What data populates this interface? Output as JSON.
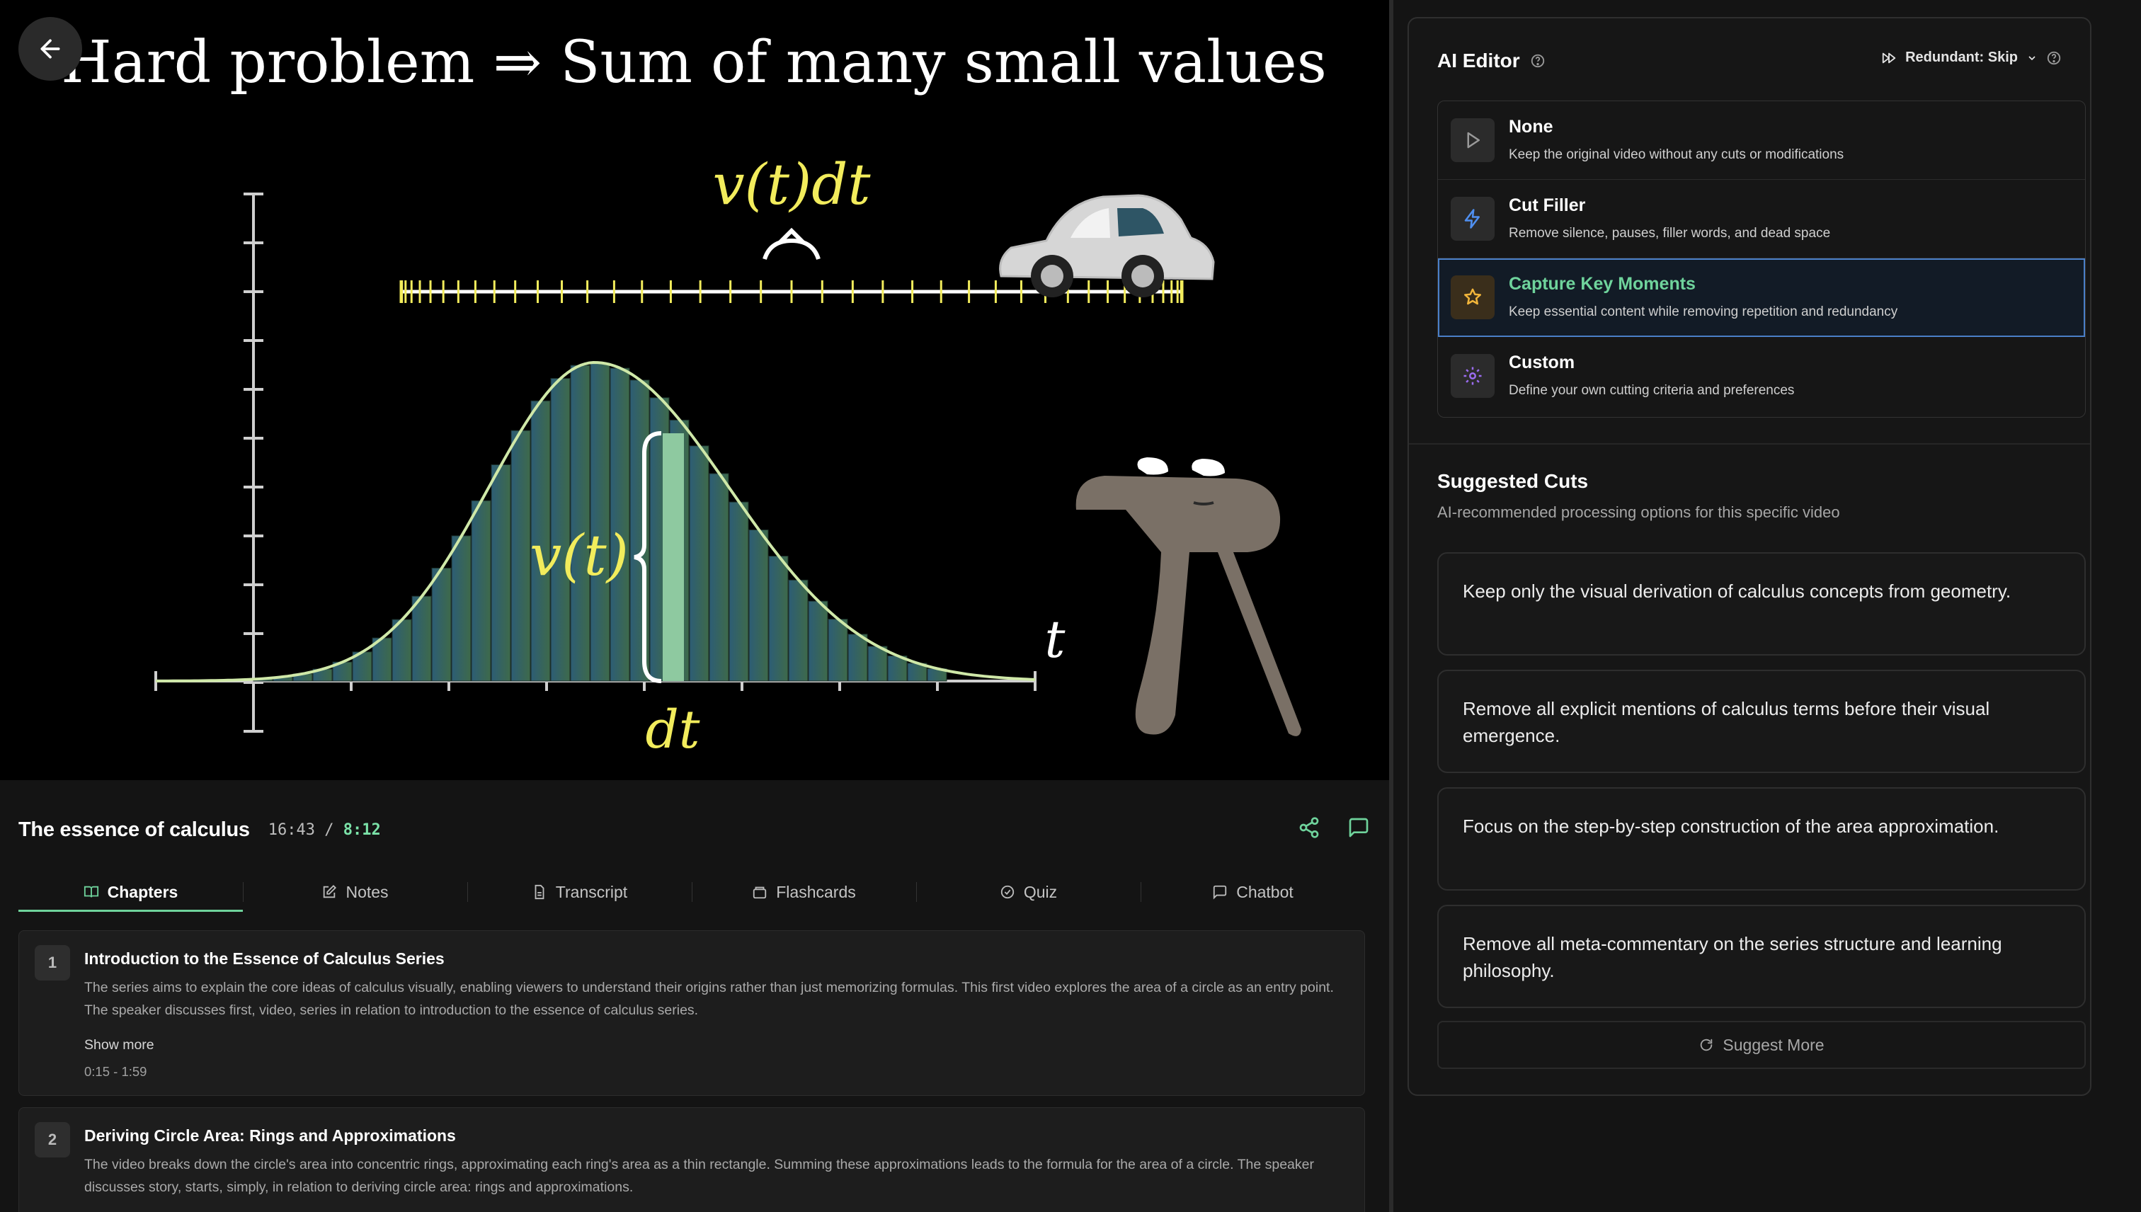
{
  "video": {
    "back_icon": "arrow-left-icon",
    "slide_title": "Hard problem ⇒ Sum of many small values",
    "label_vdt": "v(t)dt",
    "label_vt": "v(t)",
    "label_dt": "dt",
    "label_t": "t",
    "curve_color": "#d4f0a0",
    "label_color": "#f2ec5c"
  },
  "info": {
    "title": "The essence of calculus",
    "current_time": "16:43",
    "separator": "/",
    "duration": "8:12",
    "share_icon": "share-icon",
    "chat_icon": "message-icon"
  },
  "tabs": [
    {
      "label": "Chapters",
      "icon": "book-icon"
    },
    {
      "label": "Notes",
      "icon": "edit-icon"
    },
    {
      "label": "Transcript",
      "icon": "file-text-icon"
    },
    {
      "label": "Flashcards",
      "icon": "cards-icon"
    },
    {
      "label": "Quiz",
      "icon": "check-circle-icon"
    },
    {
      "label": "Chatbot",
      "icon": "message-icon"
    }
  ],
  "chapters": [
    {
      "num": "1",
      "title": "Introduction to the Essence of Calculus Series",
      "desc": "The series aims to explain the core ideas of calculus visually, enabling viewers to understand their origins rather than just memorizing formulas. This first video explores the area of a circle as an entry point. The speaker discusses first, video, series in relation to introduction to the essence of calculus series.",
      "more": "Show more",
      "range": "0:15 - 1:59"
    },
    {
      "num": "2",
      "title": "Deriving Circle Area: Rings and Approximations",
      "desc": "The video breaks down the circle's area into concentric rings, approximating each ring's area as a thin rectangle. Summing these approximations leads to the formula for the area of a circle. The speaker discusses story, starts, simply, in relation to deriving circle area: rings and approximations."
    }
  ],
  "ai_editor": {
    "title": "AI Editor",
    "redundant_label": "Redundant: Skip",
    "modes": [
      {
        "name": "None",
        "desc": "Keep the original video without any cuts or modifications",
        "icon": "play-icon"
      },
      {
        "name": "Cut Filler",
        "desc": "Remove silence, pauses, filler words, and dead space",
        "icon": "lightning-icon"
      },
      {
        "name": "Capture Key Moments",
        "desc": "Keep essential content while removing repetition and redundancy",
        "icon": "sparkle-star-icon"
      },
      {
        "name": "Custom",
        "desc": "Define your own cutting criteria and preferences",
        "icon": "gear-icon"
      }
    ],
    "suggested_title": "Suggested Cuts",
    "suggested_sub": "AI-recommended processing options for this specific video",
    "suggestions": [
      "Keep only the visual derivation of calculus concepts from geometry.",
      "Remove all explicit mentions of calculus terms before their visual emergence.",
      "Focus on the step-by-step construction of the area approximation.",
      "Remove all meta-commentary on the series structure and learning philosophy."
    ],
    "suggest_more": "Suggest More"
  }
}
